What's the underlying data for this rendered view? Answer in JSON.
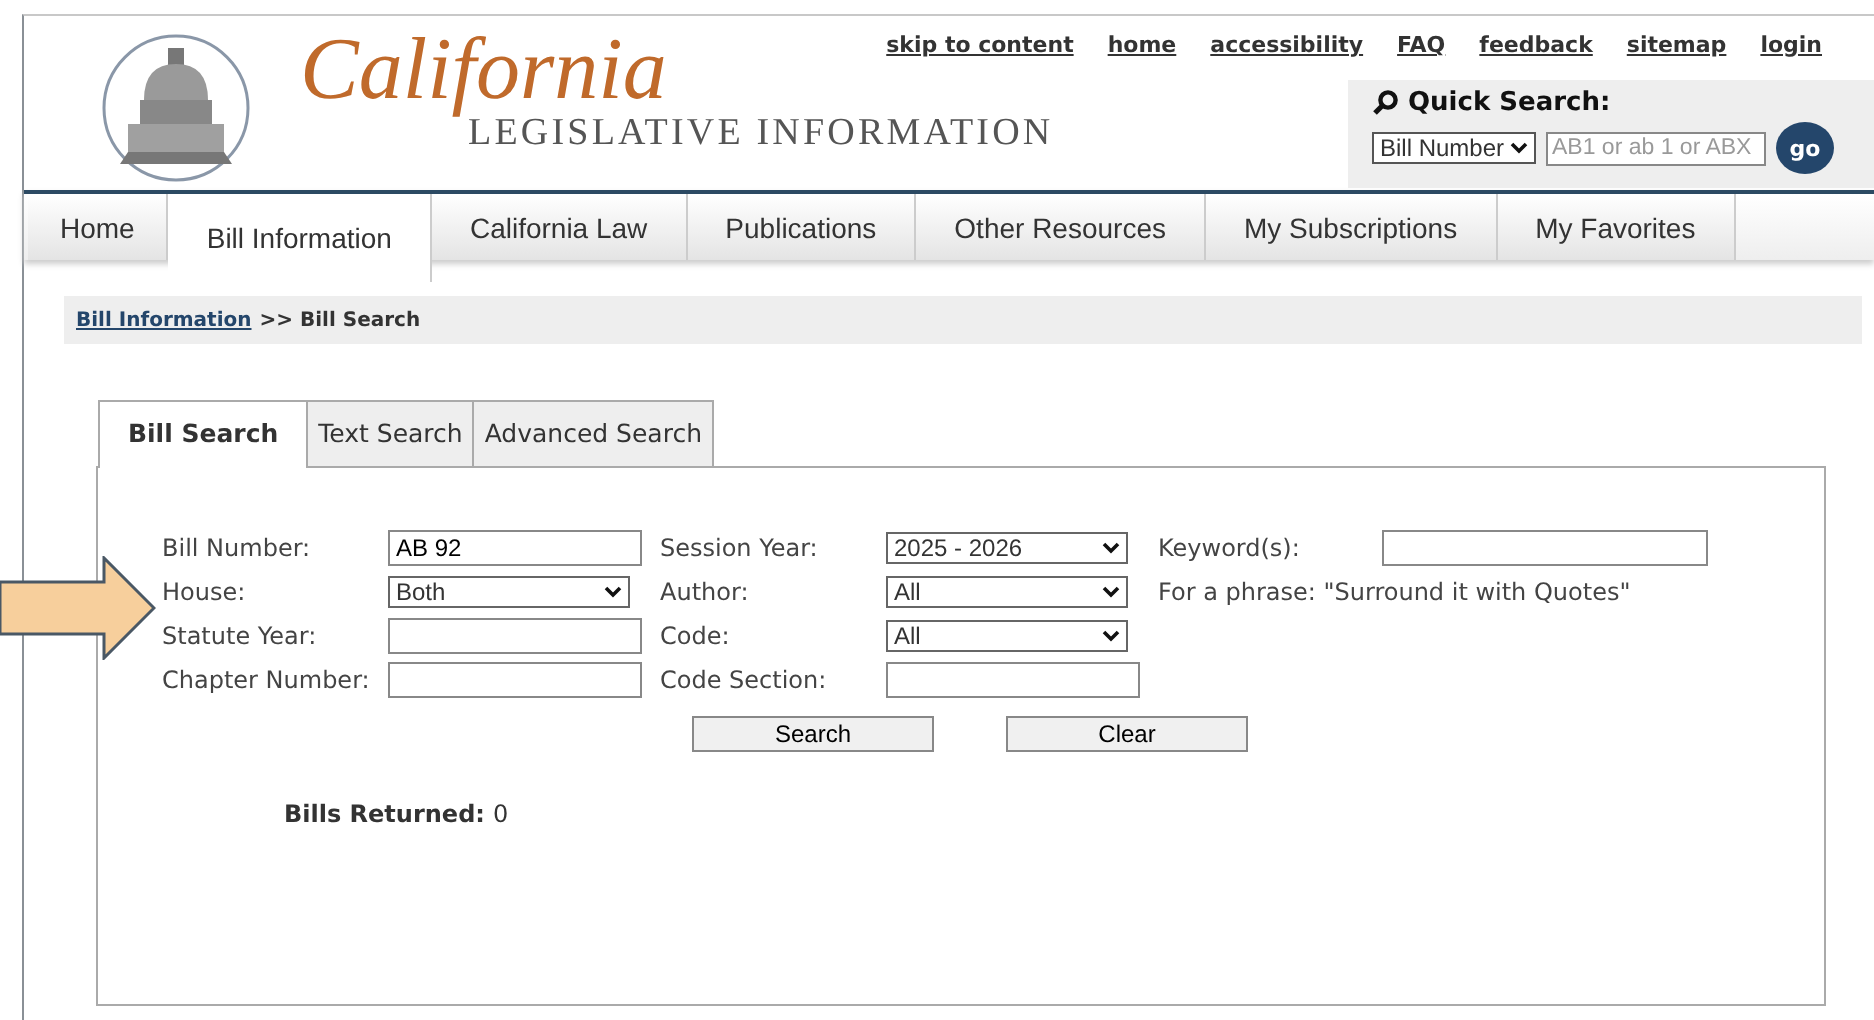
{
  "header": {
    "logo": {
      "title": "California",
      "subtitle": "LEGISLATIVE INFORMATION"
    },
    "top_links": [
      "skip to content",
      "home",
      "accessibility",
      "FAQ",
      "feedback",
      "sitemap",
      "login"
    ],
    "quick_search": {
      "label": "Quick Search:",
      "type_value": "Bill Number",
      "placeholder": "AB1 or ab 1 or ABX",
      "button": "go"
    }
  },
  "nav_tabs": [
    {
      "label": "Home",
      "selected": false
    },
    {
      "label": "Bill Information",
      "selected": true
    },
    {
      "label": "California Law",
      "selected": false
    },
    {
      "label": "Publications",
      "selected": false
    },
    {
      "label": "Other Resources",
      "selected": false
    },
    {
      "label": "My Subscriptions",
      "selected": false
    },
    {
      "label": "My Favorites",
      "selected": false
    }
  ],
  "breadcrumb": {
    "link": "Bill Information",
    "current": ">> Bill Search"
  },
  "search_tabs": [
    {
      "label": "Bill Search",
      "selected": true
    },
    {
      "label": "Text Search",
      "selected": false
    },
    {
      "label": "Advanced Search",
      "selected": false
    }
  ],
  "form_rows": [
    [
      {
        "kind": "input",
        "label": "Bill Number:",
        "value": "AB 92"
      },
      {
        "kind": "select",
        "label": "Session Year:",
        "value": "2025 - 2026"
      },
      {
        "kind": "wide_input",
        "label": "Keyword(s):"
      }
    ],
    [
      {
        "kind": "select",
        "label": "House:",
        "value": "Both"
      },
      {
        "kind": "select",
        "label": "Author:",
        "value": "All"
      },
      {
        "kind": "note",
        "label": "For a phrase: \"Surround it with Quotes\""
      }
    ],
    [
      {
        "kind": "input",
        "label": "Statute Year:"
      },
      {
        "kind": "select",
        "label": "Code:",
        "value": "All"
      }
    ],
    [
      {
        "kind": "input",
        "label": "Chapter Number:"
      },
      {
        "kind": "input",
        "label": "Code Section:"
      }
    ]
  ],
  "buttons": [
    "Search",
    "Clear"
  ],
  "results": {
    "label": "Bills Returned:",
    "value": "0"
  },
  "annotation": {
    "kind": "arrow"
  }
}
